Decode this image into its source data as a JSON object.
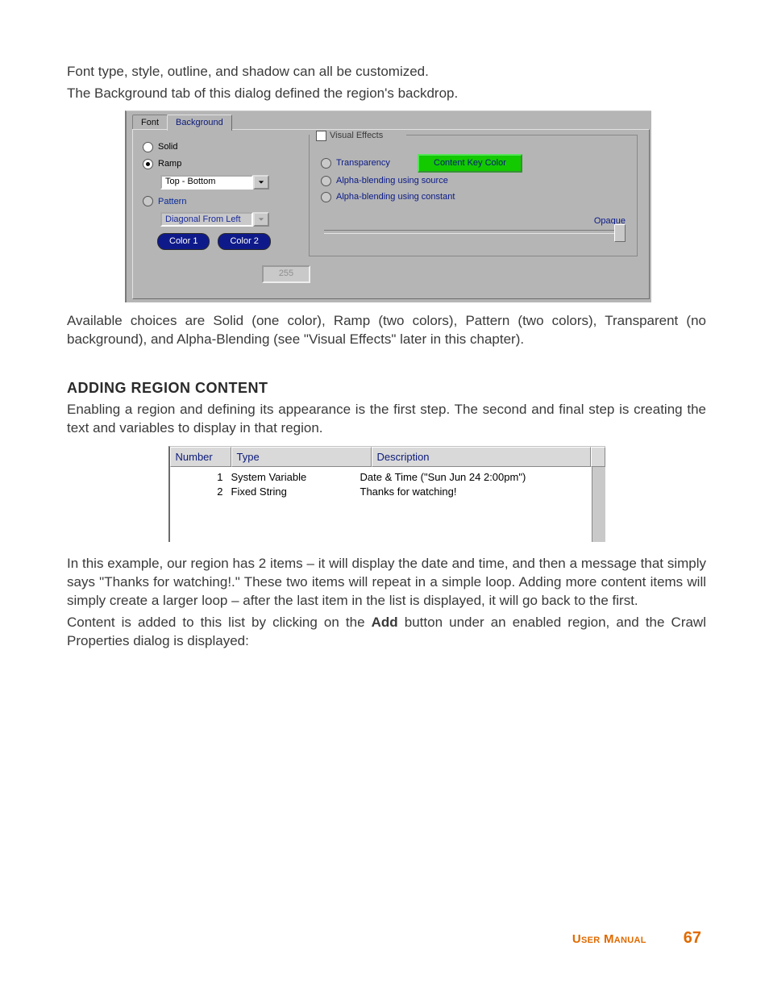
{
  "intro": {
    "p1": "Font type, style, outline, and shadow can all be customized.",
    "p2": "The Background tab of this dialog defined the region's backdrop."
  },
  "dialog": {
    "tabs": {
      "font": "Font",
      "background": "Background"
    },
    "radios": {
      "solid": "Solid",
      "ramp": "Ramp",
      "pattern": "Pattern"
    },
    "ramp_combo": "Top - Bottom",
    "pattern_combo": "Diagonal From Left",
    "color1": "Color 1",
    "color2": "Color 2",
    "group_title": "Visual Effects",
    "opt_transparency": "Transparency",
    "btn_content_key": "Content Key Color",
    "opt_alpha_src": "Alpha-blending using source",
    "opt_alpha_const": "Alpha-blending using constant",
    "opaque": "Opaque",
    "slider_value": "255"
  },
  "after1": "Available choices are Solid (one color), Ramp (two colors), Pattern (two colors), Transparent (no background), and Alpha-Blending (see \"Visual Effects\" later in this chapter).",
  "heading": "ADDING REGION CONTENT",
  "subtext": "Enabling a region and defining its appearance is the first step. The second and final step is creating the text and variables to display in that region.",
  "table": {
    "headers": {
      "number": "Number",
      "type": "Type",
      "description": "Description"
    },
    "rows": [
      {
        "number": "1",
        "type": "System Variable",
        "description": "Date & Time (\"Sun Jun 24    2:00pm\")"
      },
      {
        "number": "2",
        "type": "Fixed String",
        "description": "Thanks for watching!"
      }
    ]
  },
  "after2": "In this example, our region has 2 items – it will display the date and time, and then a message that simply says \"Thanks for watching!.\" These two items will repeat in a simple loop. Adding more content items will simply create a larger loop – after the last item in the list is displayed, it will go back to the first.",
  "after3a": "Content is added to this list by clicking on the ",
  "after3_bold": "Add",
  "after3b": " button under an enabled region, and the Crawl Properties dialog is displayed:",
  "footer": {
    "label": "User Manual",
    "page": "67"
  }
}
